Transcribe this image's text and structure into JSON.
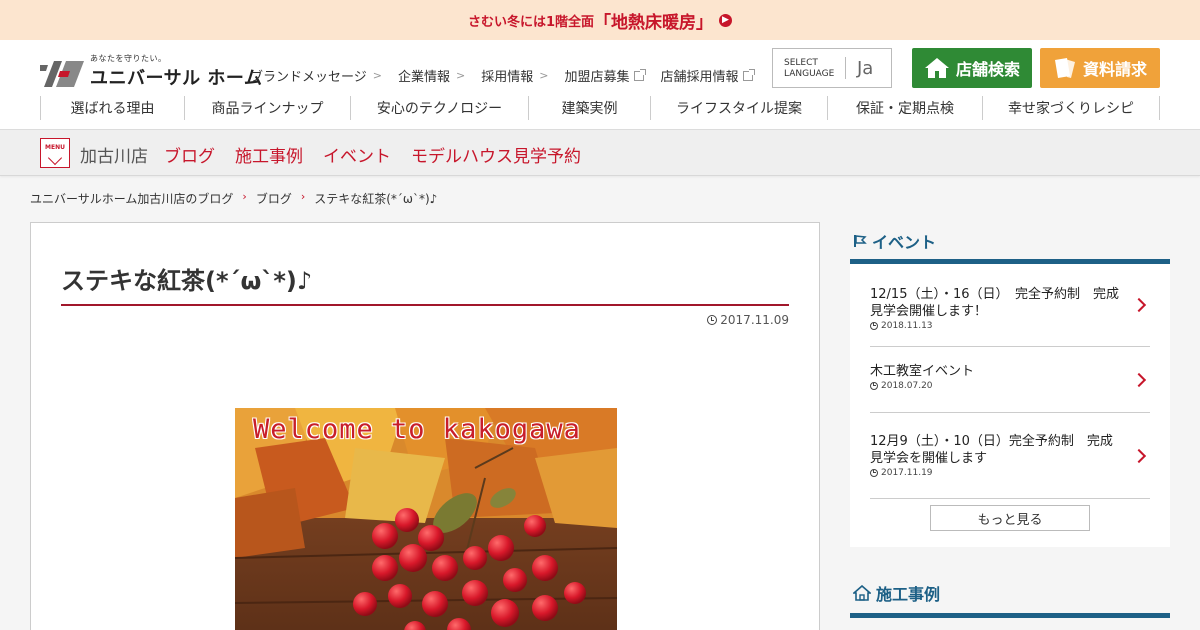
{
  "banner": {
    "pre": "さむい冬には1階全面",
    "highlight": "「地熱床暖房」"
  },
  "logo": {
    "tagline": "あなたを守りたい。",
    "name": "ユニバーサル ホーム"
  },
  "util_nav": [
    {
      "label": "ブランドメッセージ",
      "type": "chevron"
    },
    {
      "label": "企業情報",
      "type": "chevron"
    },
    {
      "label": "採用情報",
      "type": "chevron"
    },
    {
      "label": "加盟店募集",
      "type": "external"
    },
    {
      "label": "店舗採用情報",
      "type": "external"
    }
  ],
  "language": {
    "label_line1": "SELECT",
    "label_line2": "LANGUAGE",
    "value": "Ja"
  },
  "buttons": {
    "store_search": "店舗検索",
    "request_docs": "資料請求"
  },
  "main_nav": [
    "選ばれる理由",
    "商品ラインナップ",
    "安心のテクノロジー",
    "建築実例",
    "ライフスタイル提案",
    "保証・定期点検",
    "幸せ家づくりレシピ"
  ],
  "store_bar": {
    "menu_label": "MENU",
    "store_name": "加古川店",
    "links": [
      "ブログ",
      "施工事例",
      "イベント",
      "モデルハウス見学予約"
    ]
  },
  "breadcrumb": [
    "ユニバーサルホーム加古川店のブログ",
    "ブログ",
    "ステキな紅茶(*´ω`*)♪"
  ],
  "article": {
    "title": "ステキな紅茶(*´ω`*)♪",
    "date": "2017.11.09",
    "image_caption": "Welcome to kakogawa"
  },
  "sidebar": {
    "event_heading": "イベント",
    "events": [
      {
        "title": "12/15（土）・16（日）　完全予約制　完成見学会開催します！",
        "date": "2018.11.13"
      },
      {
        "title": "木工教室イベント",
        "date": "2018.07.20"
      },
      {
        "title": "12月9（土）・10（日）完全予約制　完成見学会を開催します",
        "date": "2017.11.19"
      }
    ],
    "more_label": "もっと見る",
    "works_heading": "施工事例"
  },
  "colors": {
    "brand_red": "#c7162b",
    "green": "#2f8a35",
    "orange": "#f0a23a",
    "sidebar_blue": "#1d6086",
    "banner_bg": "#fce5cf"
  }
}
